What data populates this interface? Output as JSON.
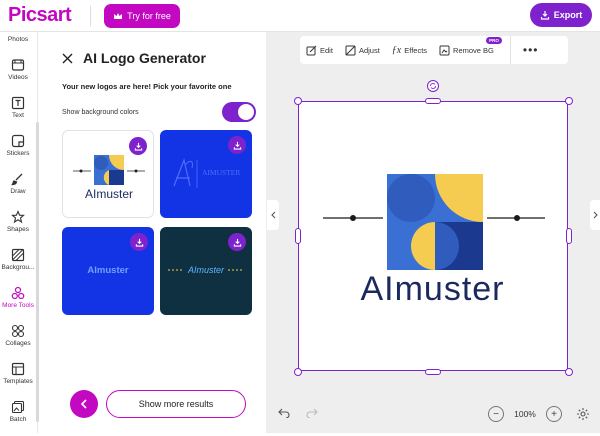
{
  "app": {
    "logo": "Picsart",
    "try_label": "Try for free",
    "export_label": "Export"
  },
  "rail": {
    "items": [
      {
        "label": "Photos",
        "icon": "photos-icon"
      },
      {
        "label": "Videos",
        "icon": "videos-icon"
      },
      {
        "label": "Text",
        "icon": "text-icon"
      },
      {
        "label": "Stickers",
        "icon": "stickers-icon"
      },
      {
        "label": "Draw",
        "icon": "draw-icon"
      },
      {
        "label": "Shapes",
        "icon": "shapes-icon"
      },
      {
        "label": "Backgrou...",
        "icon": "background-icon"
      },
      {
        "label": "More Tools",
        "icon": "more-tools-icon",
        "active": true
      },
      {
        "label": "Collages",
        "icon": "collages-icon"
      },
      {
        "label": "Templates",
        "icon": "templates-icon"
      },
      {
        "label": "Batch",
        "icon": "batch-icon"
      }
    ]
  },
  "panel": {
    "title": "AI Logo Generator",
    "subtitle": "Your new logos are here! Pick your favorite one",
    "toggle_label": "Show background colors",
    "toggle_on": true,
    "logos": [
      {
        "text": "AImuster",
        "bg": "#ffffff",
        "fg": "#1b2a5e"
      },
      {
        "text": "AIMUSTER",
        "bg": "#1334e5",
        "fg": "#4f6cff"
      },
      {
        "text": "AImuster",
        "bg": "#1334e5",
        "fg": "#6fa0ff"
      },
      {
        "text": "AImuster",
        "bg": "#0f3041",
        "fg": "#5fb4ff"
      }
    ],
    "show_more_label": "Show more results"
  },
  "toolbar": {
    "items": [
      {
        "label": "Edit",
        "icon": "edit-icon"
      },
      {
        "label": "Adjust",
        "icon": "adjust-icon"
      },
      {
        "label": "Effects",
        "icon": "effects-icon"
      },
      {
        "label": "Remove BG",
        "icon": "remove-bg-icon",
        "badge": "PRO"
      }
    ]
  },
  "canvas": {
    "logo_text": "AImuster"
  },
  "zoom": {
    "value": "100%"
  },
  "colors": {
    "brand": "#c209c1",
    "accent": "#7e22ce",
    "logo_blue": "#3a6fd4",
    "logo_yellow": "#f5cc4f",
    "logo_navy": "#1b2a5e"
  }
}
